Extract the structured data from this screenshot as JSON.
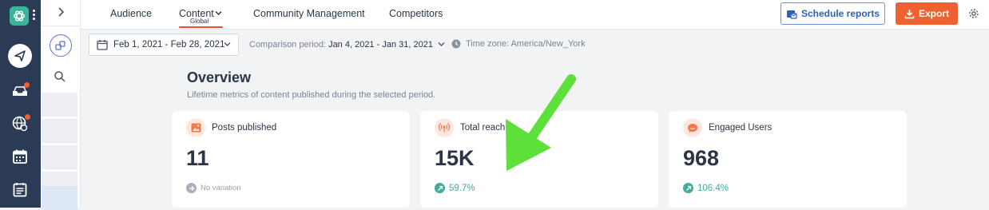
{
  "nav": {
    "tabs": [
      {
        "label": "Audience"
      },
      {
        "label": "Content",
        "sublabel": "Global",
        "active": true
      },
      {
        "label": "Community Management"
      },
      {
        "label": "Competitors"
      }
    ],
    "schedule_label": "Schedule reports",
    "export_label": "Export"
  },
  "filters": {
    "date_range": "Feb 1, 2021 - Feb 28, 2021",
    "comparison_label": "Comparison period:",
    "comparison_value": "Jan 4, 2021 - Jan 31, 2021",
    "timezone_text": "Time zone: America/New_York"
  },
  "overview": {
    "title": "Overview",
    "subtitle": "Lifetime metrics of content published during the selected period.",
    "cards": [
      {
        "label": "Posts published",
        "value": "11",
        "variation": "No variation",
        "trend": "neutral",
        "icon": "image-icon"
      },
      {
        "label": "Total reach",
        "value": "15K",
        "variation": "59.7%",
        "trend": "up",
        "icon": "broadcast-icon"
      },
      {
        "label": "Engaged Users",
        "value": "968",
        "variation": "106.4%",
        "trend": "up",
        "icon": "chat-bubble-icon"
      }
    ]
  },
  "colors": {
    "accent": "#f0612f",
    "rail": "#2b3a55",
    "positive": "#3fae9a",
    "annotation_arrow": "#5de03a",
    "link_blue": "#2f5fbd"
  }
}
